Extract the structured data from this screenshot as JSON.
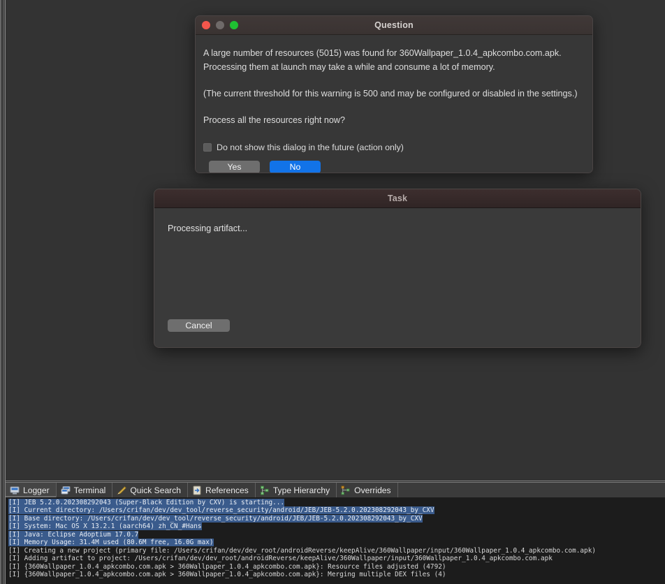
{
  "window": {
    "background_color": "#333333"
  },
  "question_dialog": {
    "title": "Question",
    "traffic_lights": {
      "close": "close-button",
      "minimize": "minimize-button",
      "zoom": "zoom-button",
      "close_color": "#f4564c",
      "minimize_color": "#6f6a69",
      "zoom_color": "#1fc032"
    },
    "message_line_1": "A large number of resources (5015) was found for 360Wallpaper_1.0.4_apkcombo.com.apk.",
    "message_line_2": "Processing them at launch may take a while and consume a lot of memory.",
    "message_line_3": "(The current threshold for this warning is 500 and may be configured or disabled in the settings.)",
    "message_line_4": "Process all the resources right now?",
    "checkbox_label": "Do not show this dialog in the future (action only)",
    "checkbox_checked": false,
    "yes_label": "Yes",
    "no_label": "No",
    "primary_color": "#1273e8"
  },
  "task_dialog": {
    "title": "Task",
    "status": "Processing artifact...",
    "cancel_label": "Cancel"
  },
  "bottom_panel": {
    "tabs": [
      {
        "label": "Logger",
        "icon": "logger-icon",
        "active": true
      },
      {
        "label": "Terminal",
        "icon": "terminal-icon",
        "active": false
      },
      {
        "label": "Quick Search",
        "icon": "quick-search-icon",
        "active": false
      },
      {
        "label": "References",
        "icon": "references-icon",
        "active": false
      },
      {
        "label": "Type Hierarchy",
        "icon": "type-hierarchy-icon",
        "active": false
      },
      {
        "label": "Overrides",
        "icon": "overrides-icon",
        "active": false
      }
    ],
    "log_lines": [
      {
        "text": "[I] JEB 5.2.0.202308292043 (Super-Black Edition by CXV) is starting...",
        "highlighted": true
      },
      {
        "text": "[I] Current directory: /Users/crifan/dev/dev_tool/reverse_security/android/JEB/JEB-5.2.0.202308292043_by_CXV",
        "highlighted": true
      },
      {
        "text": "[I] Base directory: /Users/crifan/dev/dev_tool/reverse_security/android/JEB/JEB-5.2.0.202308292043_by_CXV",
        "highlighted": true
      },
      {
        "text": "[I] System: Mac OS X 13.2.1 (aarch64) zh_CN_#Hans",
        "highlighted": true
      },
      {
        "text": "[I] Java: Eclipse Adoptium 17.0.7",
        "highlighted": true
      },
      {
        "text": "[I] Memory Usage: 31.4M used (80.6M free, 16.0G max)",
        "highlighted": true
      },
      {
        "text": "[I] Creating a new project (primary file: /Users/crifan/dev/dev_root/androidReverse/keepAlive/360Wallpaper/input/360Wallpaper_1.0.4_apkcombo.com.apk)",
        "highlighted": false
      },
      {
        "text": "[I] Adding artifact to project: /Users/crifan/dev/dev_root/androidReverse/keepAlive/360Wallpaper/input/360Wallpaper_1.0.4_apkcombo.com.apk",
        "highlighted": false
      },
      {
        "text": "[I] {360Wallpaper_1.0.4_apkcombo.com.apk > 360Wallpaper_1.0.4_apkcombo.com.apk}: Resource files adjusted (4792)",
        "highlighted": false
      },
      {
        "text": "[I] {360Wallpaper_1.0.4_apkcombo.com.apk > 360Wallpaper_1.0.4_apkcombo.com.apk}: Merging multiple DEX files (4)",
        "highlighted": false
      }
    ]
  }
}
